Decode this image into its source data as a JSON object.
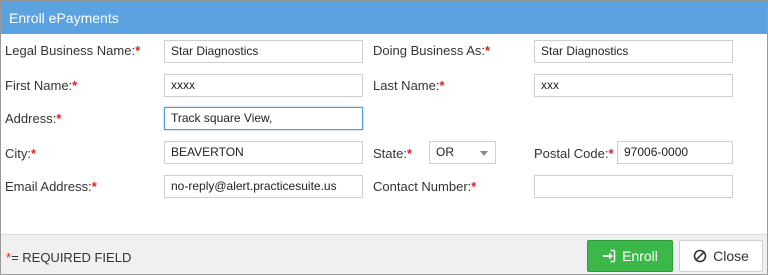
{
  "dialog": {
    "title": "Enroll ePayments",
    "colors": {
      "titlebar": "#5ba3e0",
      "required": "#e02020",
      "enroll_button": "#3cb84a"
    }
  },
  "form": {
    "legal_business_name": {
      "label": "Legal Business Name:",
      "required": "*",
      "value": "Star Diagnostics"
    },
    "doing_business_as": {
      "label": "Doing Business As:",
      "required": "*",
      "value": "Star Diagnostics"
    },
    "first_name": {
      "label": "First Name:",
      "required": "*",
      "value": "xxxx"
    },
    "last_name": {
      "label": "Last Name:",
      "required": "*",
      "value": "xxx"
    },
    "address": {
      "label": "Address:",
      "required": "*",
      "value": "Track square View,"
    },
    "city": {
      "label": "City:",
      "required": "*",
      "value": "BEAVERTON"
    },
    "state": {
      "label": "State:",
      "required": "*",
      "value": "OR"
    },
    "postal_code": {
      "label": "Postal Code:",
      "required": "*",
      "value": "97006-0000"
    },
    "email": {
      "label": "Email Address:",
      "required": "*",
      "value": "no-reply@alert.practicesuite.us"
    },
    "contact_number": {
      "label": "Contact Number:",
      "required": "*",
      "value": ""
    }
  },
  "footer": {
    "required_star": "*",
    "required_note": "= REQUIRED FIELD",
    "enroll_label": "Enroll",
    "close_label": "Close",
    "enroll_icon": "sign-in-icon",
    "close_icon": "ban-icon"
  }
}
